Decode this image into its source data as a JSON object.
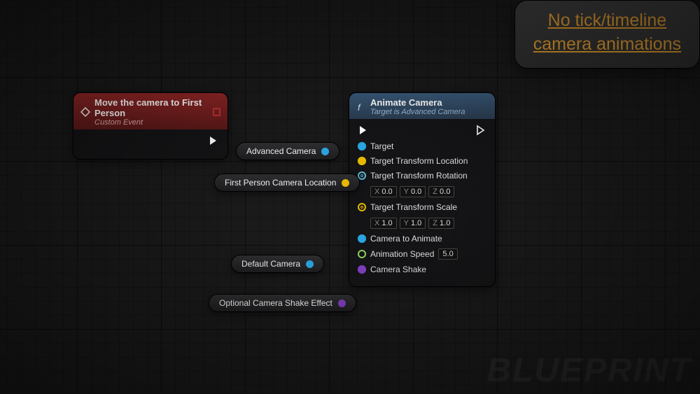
{
  "banner": {
    "line1": "No tick/timeline",
    "line2": "camera animations"
  },
  "watermark": "BLUEPRINT",
  "event_node": {
    "title": "Move the camera to First Person",
    "subtitle": "Custom Event"
  },
  "func_node": {
    "title": "Animate Camera",
    "subtitle": "Target is Advanced Camera",
    "pins": {
      "target": "Target",
      "t_loc": "Target Transform Location",
      "t_rot": "Target Transform Rotation",
      "t_scale": "Target Transform Scale",
      "cam": "Camera to Animate",
      "speed": "Animation Speed",
      "shake": "Camera Shake"
    },
    "rot": {
      "x": "0.0",
      "y": "0.0",
      "z": "0.0"
    },
    "scale": {
      "x": "1.0",
      "y": "1.0",
      "z": "1.0"
    },
    "speed_val": "5.0"
  },
  "vars": {
    "adv_cam": "Advanced Camera",
    "fp_loc": "First Person Camera Location",
    "def_cam": "Default Camera",
    "shake_fx": "Optional Camera Shake Effect"
  },
  "colors": {
    "object": "#2aa3e0",
    "vector": "#e6b800",
    "struct": "#0c6a8a",
    "float": "#8bd060",
    "class": "#8040c0"
  }
}
